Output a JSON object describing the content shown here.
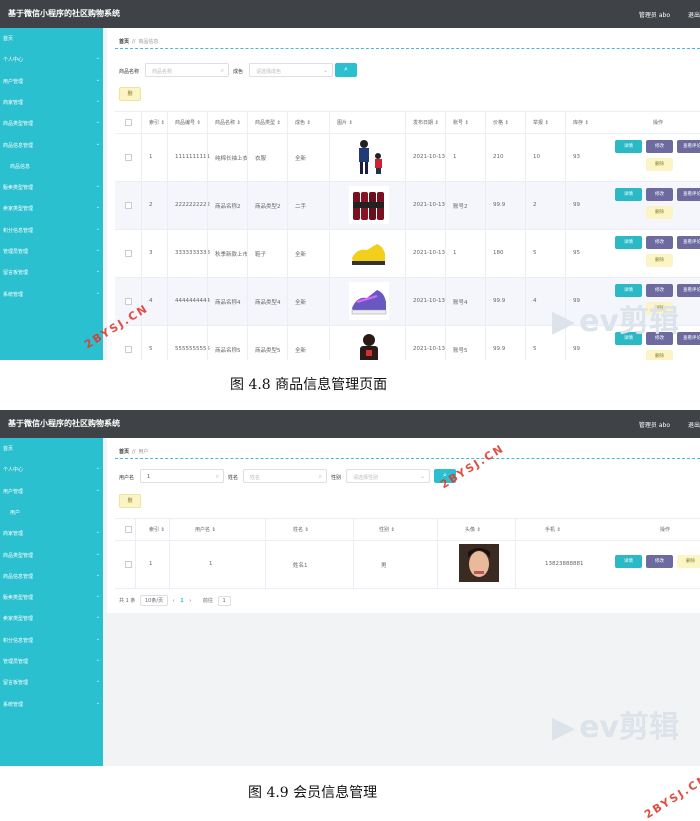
{
  "app_title": "基于微信小程序的社区购物系统",
  "header": {
    "user": "管理员 abo",
    "logout": "退出登录"
  },
  "colors": {
    "sidebar": "#2bc0cf",
    "topbar": "#3f4347",
    "accent": "#2bc0cf"
  },
  "screen1": {
    "sidebar_items": [
      {
        "label": "首页",
        "chev": ""
      },
      {
        "label": "个人中心",
        "chev": "⌄"
      },
      {
        "label": "用户管理",
        "chev": "⌄"
      },
      {
        "label": "商家管理",
        "chev": "⌄"
      },
      {
        "label": "商品类型管理",
        "chev": "⌄"
      },
      {
        "label": "商品信息管理",
        "chev": "⌄"
      },
      {
        "label": "商品信息",
        "chev": ""
      },
      {
        "label": "贩卖类型管理",
        "chev": "⌄"
      },
      {
        "label": "卖家类型管理",
        "chev": "⌄"
      },
      {
        "label": "积分信息管理",
        "chev": "⌄"
      },
      {
        "label": "管理员管理",
        "chev": "⌄"
      },
      {
        "label": "留言板管理",
        "chev": "⌄"
      },
      {
        "label": "系统管理",
        "chev": "⌄"
      }
    ],
    "breadcrumb": {
      "home": "首页",
      "sep": "//",
      "current": "商品信息"
    },
    "filters": {
      "name_label": "商品名称",
      "name_placeholder": "商品名称",
      "cond_label": "成色",
      "cond_placeholder": "请选择成色"
    },
    "search_icon": "search-icon",
    "delete_label": "删",
    "columns": [
      "索引 ⇕",
      "商品编号 ⇕",
      "商品名称 ⇕",
      "商品类型 ⇕",
      "成色 ⇕",
      "图片 ⇕",
      "发布日期 ⇕",
      "账号 ⇕",
      "价格 ⇕",
      "举报 ⇕",
      "库存 ⇕",
      "操作"
    ],
    "rows": [
      {
        "idx": "1",
        "code": "1111111111",
        "name": "纯棉长袖上衣",
        "type": "衣服",
        "cond": "全新",
        "date": "2021-10-13",
        "acct": "1",
        "price": "210",
        "report": "10",
        "stock": "93",
        "img": "person"
      },
      {
        "idx": "2",
        "code": "2222222222",
        "name": "商品名称2",
        "type": "商品类型2",
        "cond": "二手",
        "date": "2021-10-13",
        "acct": "账号2",
        "price": "99.9",
        "report": "2",
        "stock": "99",
        "img": "bottles"
      },
      {
        "idx": "3",
        "code": "3333333333",
        "name": "秋季新款上市",
        "type": "鞋子",
        "cond": "全新",
        "date": "2021-10-13",
        "acct": "1",
        "price": "180",
        "report": "5",
        "stock": "95",
        "img": "yellow-shoe"
      },
      {
        "idx": "4",
        "code": "4444444444",
        "name": "商品名称4",
        "type": "商品类型4",
        "cond": "全新",
        "date": "2021-10-13",
        "acct": "账号4",
        "price": "99.9",
        "report": "4",
        "stock": "99",
        "img": "purple-shoe"
      },
      {
        "idx": "5",
        "code": "5555555555",
        "name": "商品名称5",
        "type": "商品类型5",
        "cond": "全新",
        "date": "2021-10-13",
        "acct": "账号5",
        "price": "99.9",
        "report": "5",
        "stock": "99",
        "img": "person2"
      }
    ],
    "actions": {
      "detail": "详情",
      "edit": "修改",
      "pw": "查看评论",
      "del": "删除"
    }
  },
  "caption1": "图 4.8  商品信息管理页面",
  "screen2": {
    "sidebar_items": [
      {
        "label": "首页",
        "chev": ""
      },
      {
        "label": "个人中心",
        "chev": "⌄"
      },
      {
        "label": "用户管理",
        "chev": "⌄"
      },
      {
        "label": "用户",
        "chev": ""
      },
      {
        "label": "商家管理",
        "chev": "⌄"
      },
      {
        "label": "商品类型管理",
        "chev": "⌄"
      },
      {
        "label": "商品信息管理",
        "chev": "⌄"
      },
      {
        "label": "贩卖类型管理",
        "chev": "⌄"
      },
      {
        "label": "卖家类型管理",
        "chev": "⌄"
      },
      {
        "label": "积分信息管理",
        "chev": "⌄"
      },
      {
        "label": "管理员管理",
        "chev": "⌄"
      },
      {
        "label": "留言板管理",
        "chev": "⌄"
      },
      {
        "label": "系统管理",
        "chev": "⌄"
      }
    ],
    "breadcrumb": {
      "home": "首页",
      "sep": "//",
      "current": "用户"
    },
    "filters": {
      "user_label": "用户名",
      "user_value": "1",
      "name_label": "姓名",
      "name_placeholder": "姓名",
      "gender_label": "性别",
      "gender_placeholder": "请选择性别"
    },
    "delete_label": "删",
    "columns": [
      "索引 ⇕",
      "用户名 ⇕",
      "姓名 ⇕",
      "性别 ⇕",
      "头像 ⇕",
      "手机 ⇕",
      "操作"
    ],
    "rows": [
      {
        "idx": "1",
        "user": "1",
        "name": "姓名1",
        "gender": "男",
        "phone": "13823888881"
      }
    ],
    "actions": {
      "detail": "详情",
      "edit": "修改",
      "del": "删除"
    },
    "pager": {
      "total": "共 1 条",
      "size": "10条/页",
      "prev": "‹",
      "page": "1",
      "next": "›",
      "goto": "前往",
      "goto_val": "1"
    }
  },
  "caption2": "图 4.9 会员信息管理",
  "watermark": {
    "site": "2BYSJ.CN",
    "brand": "ev剪辑"
  }
}
